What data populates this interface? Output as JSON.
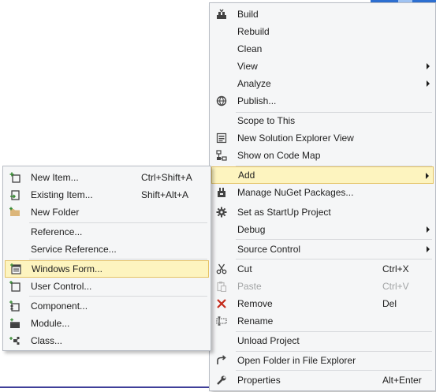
{
  "main_menu": {
    "items": [
      {
        "label": "Build",
        "icon": "build-icon"
      },
      {
        "label": "Rebuild"
      },
      {
        "label": "Clean"
      },
      {
        "label": "View",
        "submenu": true
      },
      {
        "label": "Analyze",
        "submenu": true
      },
      {
        "label": "Publish...",
        "icon": "publish-globe-icon"
      },
      {
        "label": "Scope to This"
      },
      {
        "label": "New Solution Explorer View",
        "icon": "new-explorer-view-icon"
      },
      {
        "label": "Show on Code Map",
        "icon": "code-map-icon"
      },
      {
        "label": "Add",
        "submenu": true,
        "highlighted": true
      },
      {
        "label": "Manage NuGet Packages...",
        "icon": "nuget-icon"
      },
      {
        "label": "Set as StartUp Project",
        "icon": "gear-icon"
      },
      {
        "label": "Debug",
        "submenu": true
      },
      {
        "label": "Source Control",
        "submenu": true
      },
      {
        "label": "Cut",
        "shortcut": "Ctrl+X",
        "icon": "scissors-icon"
      },
      {
        "label": "Paste",
        "shortcut": "Ctrl+V",
        "disabled": true,
        "icon": "paste-icon"
      },
      {
        "label": "Remove",
        "shortcut": "Del",
        "icon": "remove-x-icon"
      },
      {
        "label": "Rename",
        "icon": "rename-icon"
      },
      {
        "label": "Unload Project"
      },
      {
        "label": "Open Folder in File Explorer",
        "icon": "open-folder-arrow-icon"
      },
      {
        "label": "Properties",
        "shortcut": "Alt+Enter",
        "icon": "wrench-icon"
      }
    ]
  },
  "add_submenu": {
    "items": [
      {
        "label": "New Item...",
        "shortcut": "Ctrl+Shift+A",
        "icon": "new-item-icon"
      },
      {
        "label": "Existing Item...",
        "shortcut": "Shift+Alt+A",
        "icon": "existing-item-icon"
      },
      {
        "label": "New Folder",
        "icon": "folder-icon"
      },
      {
        "label": "Reference..."
      },
      {
        "label": "Service Reference..."
      },
      {
        "label": "Windows Form...",
        "highlighted": true,
        "icon": "windows-form-icon"
      },
      {
        "label": "User Control...",
        "icon": "user-control-icon"
      },
      {
        "label": "Component...",
        "icon": "component-icon"
      },
      {
        "label": "Module...",
        "icon": "module-icon"
      },
      {
        "label": "Class...",
        "icon": "class-icon"
      }
    ]
  },
  "colors": {
    "menu_background": "#f5f6f7",
    "highlight_background": "#fdf4bf",
    "highlight_border": "#e5c365",
    "disabled_text": "#a2a4a5",
    "remove_red": "#c42b1c"
  }
}
